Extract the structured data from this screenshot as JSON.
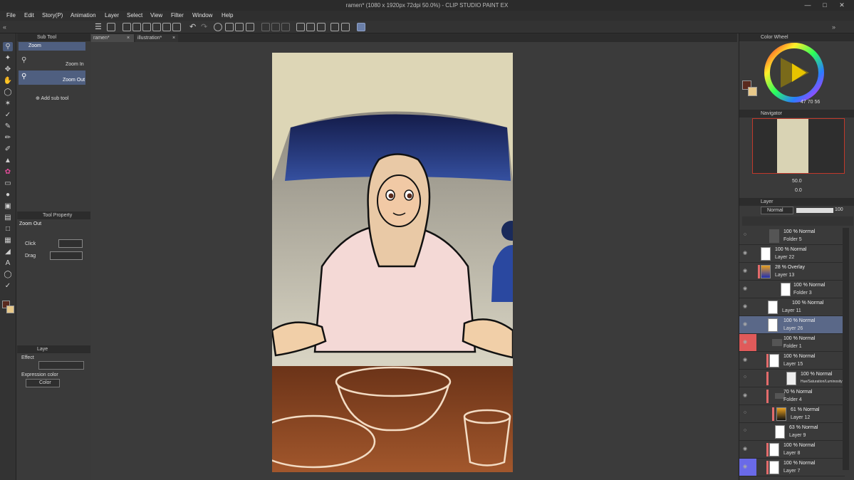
{
  "window": {
    "title": "ramen* (1080 x 1920px 72dpi 50.0%) - CLIP STUDIO PAINT EX",
    "minimize": "—",
    "maximize": "□",
    "close": "✕"
  },
  "menu": [
    "File",
    "Edit",
    "Story(P)",
    "Animation",
    "Layer",
    "Select",
    "View",
    "Filter",
    "Window",
    "Help"
  ],
  "doc_tabs": [
    {
      "label": "ramen*",
      "close": "×"
    },
    {
      "label": "illustration*",
      "close": "×"
    }
  ],
  "sub_tool": {
    "tab_label": "Sub Tool",
    "group_label": "Zoom",
    "items": [
      "Zoom In",
      "Zoom Out"
    ],
    "add_label": "Add sub tool"
  },
  "tool_property": {
    "tab_label": "Tool Property",
    "title": "Zoom Out",
    "click_label": "Click",
    "drag_label": "Drag"
  },
  "layer_property": {
    "tab_label": "Laye",
    "effect_label": "Effect",
    "expression_label": "Expression color",
    "expression_value": "Color"
  },
  "color_wheel": {
    "tab_label": "Color Wheel",
    "h": "47",
    "s": "70",
    "v": "56",
    "main_color": "#5a2a1e",
    "sub_color": "#e8c98a"
  },
  "navigator": {
    "tab_label": "Navigator",
    "zoom": "50.0",
    "rotation": "0.0"
  },
  "layer_panel": {
    "tab_label": "Layer",
    "blend_mode": "Normal",
    "opacity": "100",
    "layers": [
      {
        "blend": "100 % Normal",
        "name": "Folder 5",
        "type": "folder",
        "selected": false
      },
      {
        "blend": "100 % Normal",
        "name": "Layer 22",
        "type": "raster",
        "selected": false
      },
      {
        "blend": "28 % Overlay",
        "name": "Layer 13",
        "type": "raster",
        "selected": false
      },
      {
        "blend": "100 % Normal",
        "name": "Folder 3",
        "type": "folder",
        "selected": false
      },
      {
        "blend": "100 % Normal",
        "name": "Layer 11",
        "type": "raster",
        "selected": false
      },
      {
        "blend": "100 % Normal",
        "name": "Layer 26",
        "type": "raster",
        "selected": true
      },
      {
        "blend": "100 % Normal",
        "name": "Folder 1",
        "type": "folder",
        "selected": false
      },
      {
        "blend": "100 % Normal",
        "name": "Layer 15",
        "type": "raster",
        "selected": false
      },
      {
        "blend": "100 % Normal",
        "name": "Hue/Saturation/Luminosity",
        "type": "correction",
        "selected": false
      },
      {
        "blend": "70 % Normal",
        "name": "Folder 4",
        "type": "folder",
        "selected": false
      },
      {
        "blend": "61 % Normal",
        "name": "Layer 12",
        "type": "raster",
        "selected": false
      },
      {
        "blend": "63 % Normal",
        "name": "Layer 9",
        "type": "raster",
        "selected": false
      },
      {
        "blend": "100 % Normal",
        "name": "Layer 8",
        "type": "raster",
        "selected": false
      },
      {
        "blend": "100 % Normal",
        "name": "Layer 7",
        "type": "raster",
        "selected": false
      }
    ]
  }
}
